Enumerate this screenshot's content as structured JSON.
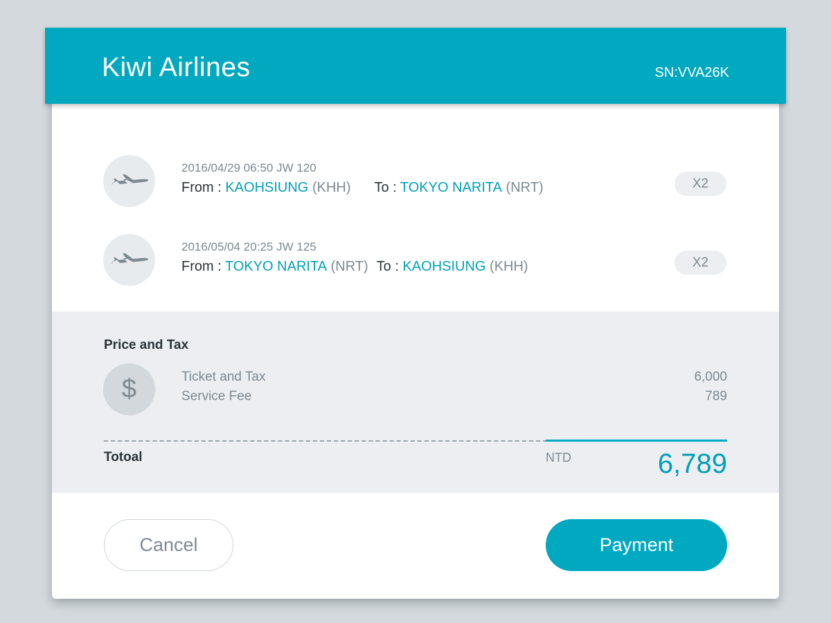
{
  "header": {
    "brand": "Kiwi Airlines",
    "serial": "SN:VVA26K"
  },
  "flights": [
    {
      "meta": "2016/04/29 06:50 JW 120",
      "from_label": "From : ",
      "from_city": "KAOHSIUNG",
      "from_code": "(KHH)",
      "to_label": "To : ",
      "to_city": "TOKYO NARITA",
      "to_code": "(NRT)",
      "quantity": "X2",
      "icon": "airplane-icon"
    },
    {
      "meta": "2016/05/04 20:25 JW 125",
      "from_label": "From : ",
      "from_city": "TOKYO NARITA",
      "from_code": "(NRT)",
      "to_label": "To : ",
      "to_city": "KAOHSIUNG",
      "to_code": "(KHH)",
      "quantity": "X2",
      "icon": "airplane-icon"
    }
  ],
  "price": {
    "title": "Price and Tax",
    "icon": "dollar-icon",
    "icon_glyph": "$",
    "lines": [
      {
        "label": "Ticket and Tax",
        "value": "6,000"
      },
      {
        "label": "Service Fee",
        "value": "789"
      }
    ],
    "total_label": "Totoal",
    "currency": "NTD",
    "total_value": "6,789"
  },
  "actions": {
    "cancel_label": "Cancel",
    "payment_label": "Payment"
  },
  "colors": {
    "accent": "#00a9bf",
    "background": "#d3d9dc",
    "panel": "#eceef1",
    "muted_text": "#7d8a92",
    "dark_text": "#2b3338"
  }
}
